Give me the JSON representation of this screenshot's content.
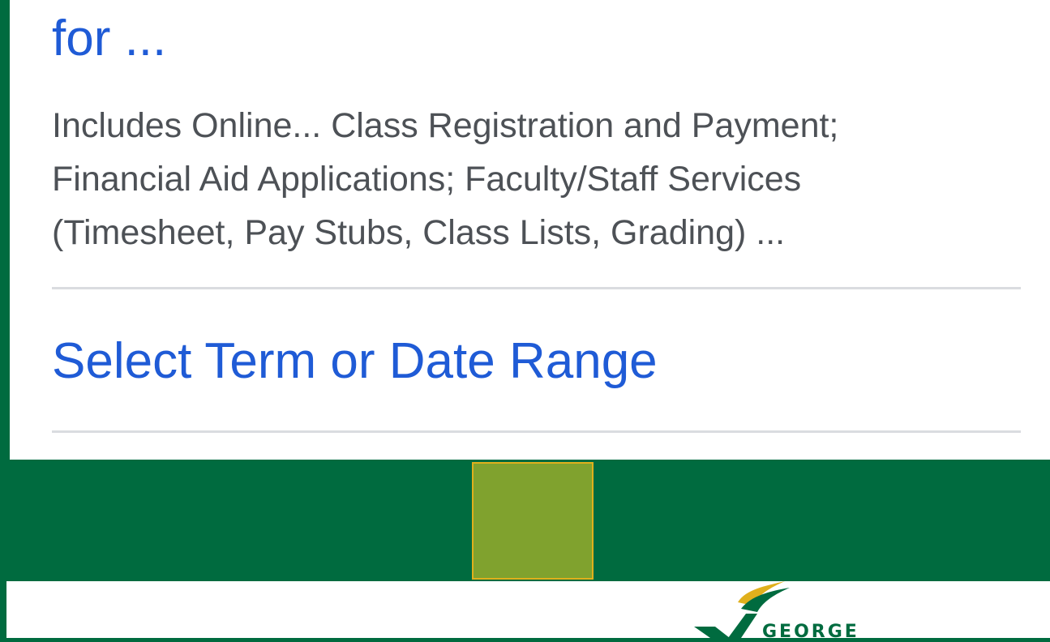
{
  "result": {
    "title": "for ...",
    "snippet_lines": [
      "Includes Online... Class Registration and Payment;",
      "Financial Aid Applications; Faculty/Staff Services",
      "(Timesheet, Pay Stubs, Class Lists, Grading) ..."
    ],
    "sub_link": "Select Term or Date Range"
  },
  "footer": {
    "logo_text": "GEORGE"
  },
  "colors": {
    "link": "#1f5bd6",
    "snippet": "#4d5156",
    "brand_green": "#006b3f",
    "olive": "#80a22e",
    "gold": "#e0b01c"
  }
}
